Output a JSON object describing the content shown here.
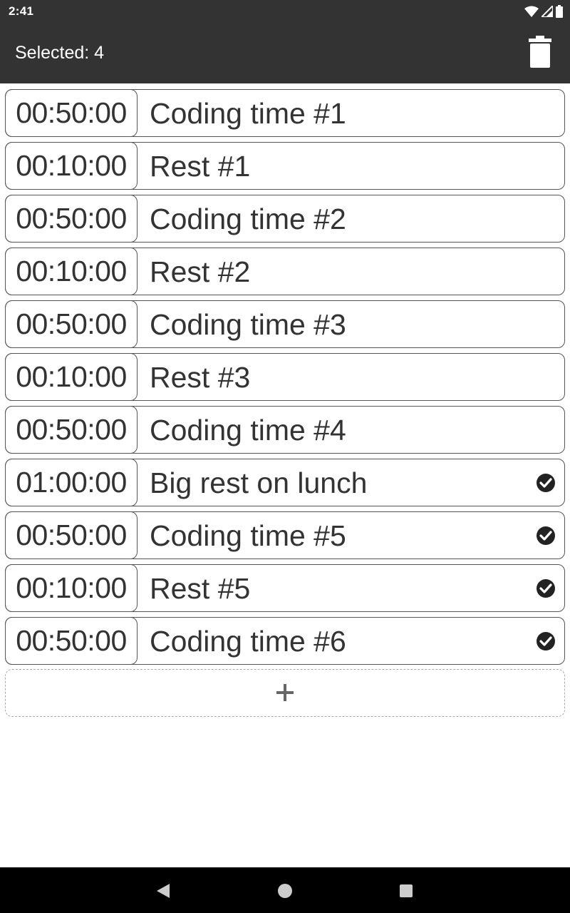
{
  "status_bar": {
    "time": "2:41",
    "icons": [
      "wifi-icon",
      "signal-icon",
      "battery-icon"
    ]
  },
  "app_bar": {
    "title": "Selected: 4",
    "action_icon": "trash-icon"
  },
  "colors": {
    "bar_background": "#333333",
    "row_border": "#555555",
    "text": "#333333",
    "nav_background": "#000000"
  },
  "rows": [
    {
      "time": "00:50:00",
      "title": "Coding time #1",
      "selected": false
    },
    {
      "time": "00:10:00",
      "title": "Rest #1",
      "selected": false
    },
    {
      "time": "00:50:00",
      "title": "Coding time #2",
      "selected": false
    },
    {
      "time": "00:10:00",
      "title": "Rest #2",
      "selected": false
    },
    {
      "time": "00:50:00",
      "title": "Coding time #3",
      "selected": false
    },
    {
      "time": "00:10:00",
      "title": "Rest #3",
      "selected": false
    },
    {
      "time": "00:50:00",
      "title": "Coding time #4",
      "selected": false
    },
    {
      "time": "01:00:00",
      "title": "Big rest on lunch",
      "selected": true
    },
    {
      "time": "00:50:00",
      "title": "Coding time #5",
      "selected": true
    },
    {
      "time": "00:10:00",
      "title": "Rest #5",
      "selected": true
    },
    {
      "time": "00:50:00",
      "title": "Coding time #6",
      "selected": true
    }
  ],
  "add_button": {
    "icon": "plus-icon"
  },
  "nav_bar": {
    "icons": [
      "back-icon",
      "home-icon",
      "recents-icon"
    ]
  }
}
